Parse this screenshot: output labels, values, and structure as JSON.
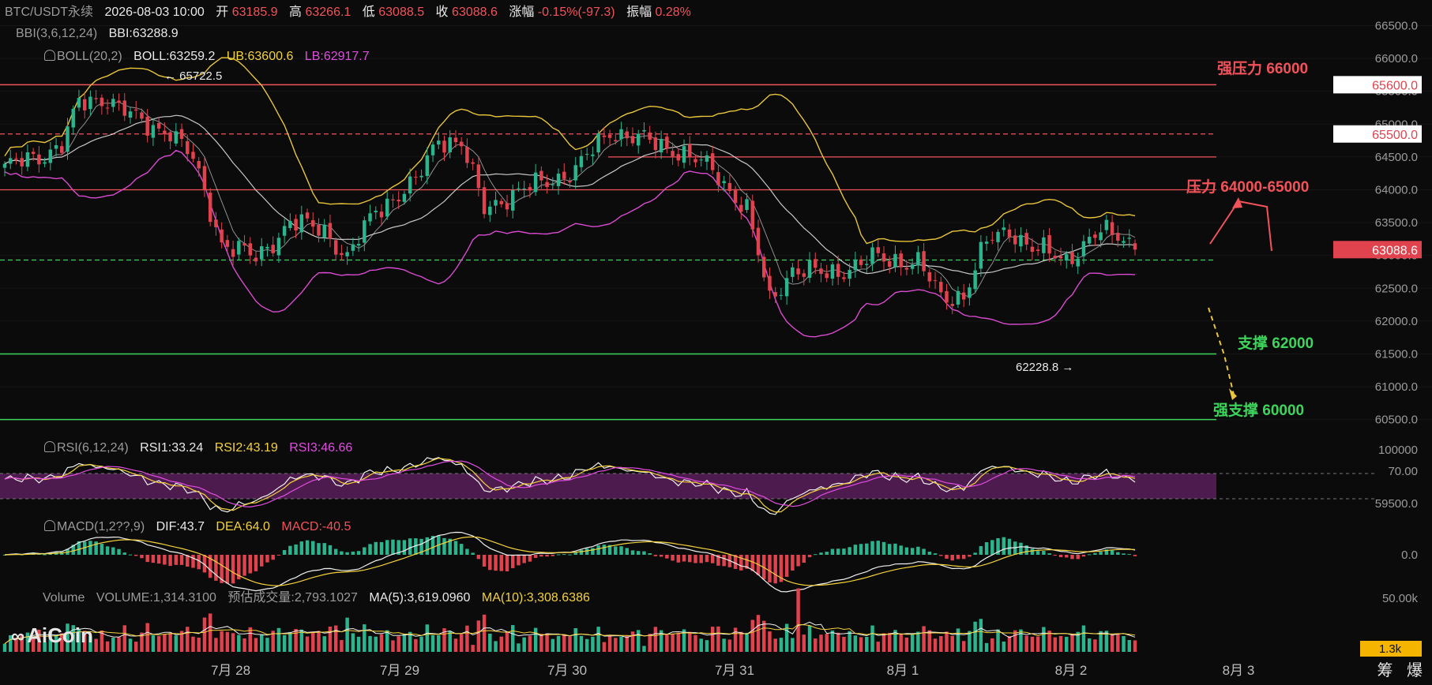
{
  "header": {
    "symbol": "BTC/USDT永续",
    "datetime": "2026-08-03 10:00",
    "open_label": "开",
    "open": "63185.9",
    "high_label": "高",
    "high": "63266.1",
    "low_label": "低",
    "low": "63088.5",
    "close_label": "收",
    "close": "63088.6",
    "change_label": "涨幅",
    "change": "-0.15%(-97.3)",
    "amplitude_label": "振幅",
    "amplitude": "0.28%"
  },
  "indicators": {
    "bbi_name": "BBI(3,6,12,24)",
    "bbi_value": "BBI:63288.9",
    "boll_name": "BOLL(20,2)",
    "boll_mid": "BOLL:63259.2",
    "boll_ub": "UB:63600.6",
    "boll_lb": "LB:62917.7",
    "rsi_name": "RSI(6,12,24)",
    "rsi1": "RSI1:33.24",
    "rsi2": "RSI2:43.19",
    "rsi3": "RSI3:46.66",
    "macd_name": "MACD(1,2??,9)",
    "dif": "DIF:43.7",
    "dea": "DEA:64.0",
    "macd": "MACD:-40.5",
    "vol_name": "Volume",
    "vol": "VOLUME:1,314.3100",
    "vol_est": "预估成交量:2,793.1027",
    "ma5": "MA(5):3,619.0960",
    "ma10": "MA(10):3,308.6386"
  },
  "annotations": {
    "high_marker": "← 65722.5",
    "low_marker": "62228.8 →",
    "strong_resistance": "强压力 66000",
    "resistance": "压力 64000-65000",
    "support": "支撑 62000",
    "strong_support": "强支撑 60000"
  },
  "price_axis": {
    "ticks": [
      "66500.0",
      "66000.0",
      "65500.0",
      "65000.0",
      "64500.0",
      "64000.0",
      "63500.0",
      "63000.0",
      "62500.0",
      "62000.0",
      "61500.0",
      "61000.0",
      "60500.0"
    ],
    "tag_strong_resistance": "65600.0",
    "tag_resistance": "65500.0",
    "tag_last": "63088.6"
  },
  "rsi_axis": {
    "ticks": [
      "100000",
      "70.00",
      "59500.0"
    ]
  },
  "macd_axis": {
    "ticks": [
      "0.0"
    ]
  },
  "vol_axis": {
    "ticks": [
      "50.00k"
    ],
    "tag": "1.3k"
  },
  "time_axis": {
    "labels": [
      "7月 28",
      "7月 29",
      "7月 30",
      "7月 31",
      "8月 1",
      "8月 2",
      "8月 3"
    ]
  },
  "brand": {
    "name": "AiCoin",
    "corner": "筹 爆"
  },
  "colors": {
    "up": "#2bb58f",
    "down": "#e0434e",
    "boll_ub": "#e8c53a",
    "boll_lb": "#d94bd0",
    "boll_mid": "#e8e8e8",
    "bbi": "#e8e8e8",
    "resistance": "#f2525a",
    "support": "#3dd55b",
    "rsi_band": "#5a1f5a"
  },
  "chart_data": {
    "type": "candlestick",
    "symbol": "BTC/USDT永续",
    "interval": "hourly",
    "ylim": [
      60400,
      66650
    ],
    "x_labels": [
      "7月 28",
      "7月 29",
      "7月 30",
      "7月 31",
      "8月 1",
      "8月 2",
      "8月 3"
    ],
    "price_anchors": [
      {
        "t": 0,
        "p": 64350
      },
      {
        "t": 6,
        "p": 64500
      },
      {
        "t": 10,
        "p": 64700
      },
      {
        "t": 13,
        "p": 65300
      },
      {
        "t": 18,
        "p": 65400
      },
      {
        "t": 24,
        "p": 65000
      },
      {
        "t": 29,
        "p": 64900
      },
      {
        "t": 33,
        "p": 64450
      },
      {
        "t": 38,
        "p": 63200
      },
      {
        "t": 44,
        "p": 62950
      },
      {
        "t": 50,
        "p": 63500
      },
      {
        "t": 56,
        "p": 63400
      },
      {
        "t": 60,
        "p": 62950
      },
      {
        "t": 65,
        "p": 63700
      },
      {
        "t": 72,
        "p": 64100
      },
      {
        "t": 76,
        "p": 64800
      },
      {
        "t": 80,
        "p": 64700
      },
      {
        "t": 84,
        "p": 63700
      },
      {
        "t": 88,
        "p": 63900
      },
      {
        "t": 94,
        "p": 64100
      },
      {
        "t": 100,
        "p": 64300
      },
      {
        "t": 106,
        "p": 64900
      },
      {
        "t": 112,
        "p": 64750
      },
      {
        "t": 118,
        "p": 64600
      },
      {
        "t": 124,
        "p": 64300
      },
      {
        "t": 130,
        "p": 63700
      },
      {
        "t": 134,
        "p": 62300
      },
      {
        "t": 138,
        "p": 62800
      },
      {
        "t": 144,
        "p": 62700
      },
      {
        "t": 152,
        "p": 62950
      },
      {
        "t": 160,
        "p": 62900
      },
      {
        "t": 164,
        "p": 62350
      },
      {
        "t": 168,
        "p": 62400
      },
      {
        "t": 172,
        "p": 63200
      },
      {
        "t": 176,
        "p": 63400
      },
      {
        "t": 180,
        "p": 63100
      },
      {
        "t": 186,
        "p": 62950
      },
      {
        "t": 192,
        "p": 63350
      },
      {
        "t": 196,
        "p": 63300
      },
      {
        "t": 198,
        "p": 63088.6
      }
    ],
    "high": 65722.5,
    "low": 62228.8,
    "last": {
      "open": 63185.9,
      "high": 63266.1,
      "low": 63088.5,
      "close": 63088.6
    },
    "levels": [
      {
        "label": "强压力 66000",
        "value": 65600
      },
      {
        "label": "压力 64000-65000",
        "value": 64000
      },
      {
        "label": "支撑 62000",
        "value": 61500
      },
      {
        "label": "强支撑 60000",
        "value": 60500
      }
    ],
    "boll": {
      "mid": 63259.2,
      "ub": 63600.6,
      "lb": 62917.7
    },
    "bbi": 63288.9,
    "rsi": {
      "rsi1": 33.24,
      "rsi2": 43.19,
      "rsi3": 46.66
    },
    "macd": {
      "dif": 43.7,
      "dea": 64.0,
      "macd": -40.5
    },
    "volume": {
      "volume": 1314.31,
      "estimated": 2793.1027,
      "ma5": 3619.096,
      "ma10": 3308.6386
    }
  }
}
